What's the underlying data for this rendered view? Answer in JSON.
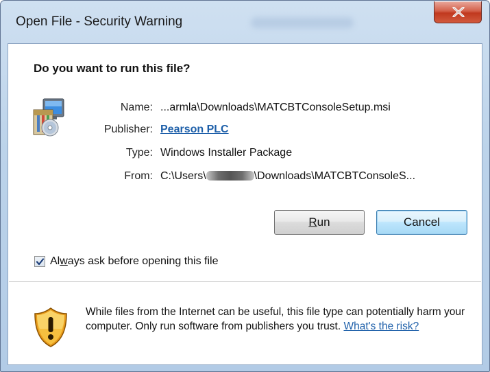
{
  "window": {
    "title": "Open File - Security Warning"
  },
  "dialog": {
    "heading": "Do you want to run this file?",
    "fields": {
      "name_label": "Name:",
      "name_value": "...armla\\Downloads\\MATCBTConsoleSetup.msi",
      "publisher_label": "Publisher:",
      "publisher_value": "Pearson PLC",
      "type_label": "Type:",
      "type_value": "Windows Installer Package",
      "from_label": "From:",
      "from_value_prefix": "C:\\Users\\",
      "from_value_suffix": "\\Downloads\\MATCBTConsoleS..."
    },
    "buttons": {
      "run": {
        "pre": "",
        "accel": "R",
        "post": "un"
      },
      "cancel": "Cancel"
    },
    "checkbox": {
      "checked": true,
      "label_pre": "Al",
      "label_accel": "w",
      "label_post": "ays ask before opening this file"
    },
    "warning": {
      "text": "While files from the Internet can be useful, this file type can potentially harm your computer. Only run software from publishers you trust. ",
      "link": "What's the risk?"
    }
  },
  "icons": {
    "close": "close-icon",
    "installer": "windows-installer-icon",
    "shield": "warning-shield-icon",
    "check": "check-icon"
  },
  "colors": {
    "link": "#1d5fa9",
    "close_button": "#c0391f",
    "default_button_border": "#3c7fb1"
  }
}
